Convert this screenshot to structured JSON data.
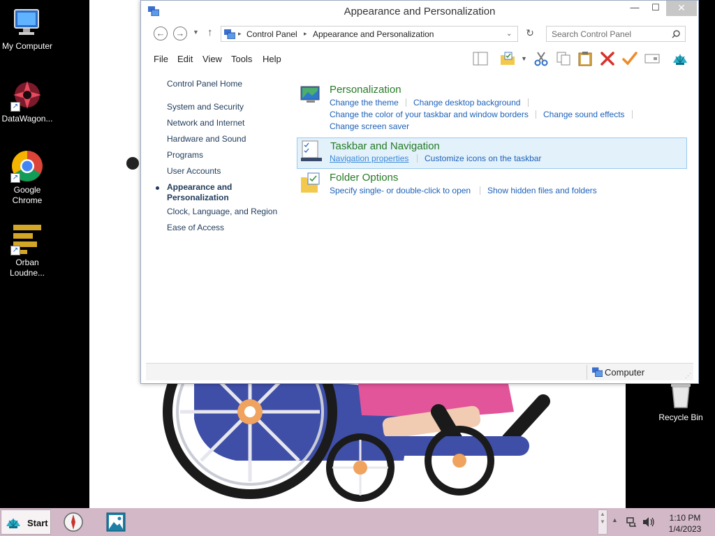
{
  "desktop": {
    "icons": [
      {
        "label": "My Computer",
        "icon": "my-computer-icon"
      },
      {
        "label": "DataWagon...",
        "icon": "datawagon-icon"
      },
      {
        "label": "Google Chrome",
        "icon": "chrome-icon"
      },
      {
        "label": "Orban Loudne...",
        "icon": "orban-loudness-icon"
      },
      {
        "label": "Recycle Bin",
        "icon": "recycle-bin-icon"
      }
    ]
  },
  "window": {
    "title": "Appearance and Personalization",
    "controls": {
      "minimize": "—",
      "maximize": "☐",
      "close": "✕"
    },
    "address": {
      "crumbs": [
        "Control Panel",
        "Appearance and Personalization"
      ]
    },
    "search": {
      "placeholder": "Search Control Panel"
    },
    "menu": [
      "File",
      "Edit",
      "View",
      "Tools",
      "Help"
    ],
    "left_nav": {
      "home": "Control Panel Home",
      "items": [
        "System and Security",
        "Network and Internet",
        "Hardware and Sound",
        "Programs",
        "User Accounts",
        "Appearance and Personalization",
        "Clock, Language, and Region",
        "Ease of Access"
      ],
      "active": "Appearance and Personalization"
    },
    "categories": [
      {
        "title": "Personalization",
        "icon": "personalization-icon",
        "links": [
          "Change the theme",
          "Change desktop background",
          "Change the color of your taskbar and window borders",
          "Change sound effects",
          "Change screen saver"
        ]
      },
      {
        "title": "Taskbar and Navigation",
        "icon": "taskbar-navigation-icon",
        "highlighted": true,
        "links": [
          "Navigation properties",
          "Customize icons on the taskbar"
        ]
      },
      {
        "title": "Folder Options",
        "icon": "folder-options-icon",
        "links": [
          "Specify single- or double-click to open",
          "Show hidden files and folders"
        ]
      }
    ],
    "status": {
      "text": "Computer"
    }
  },
  "taskbar": {
    "start_label": "Start",
    "time": "1:10 PM",
    "date": "1/4/2023",
    "apps": [
      "compass-app-icon",
      "image-viewer-app-icon"
    ]
  },
  "colors": {
    "category_title": "#267a26",
    "link": "#1d61b8",
    "highlight_bg": "#e3f1fb",
    "taskbar": "#d3b9c8"
  }
}
